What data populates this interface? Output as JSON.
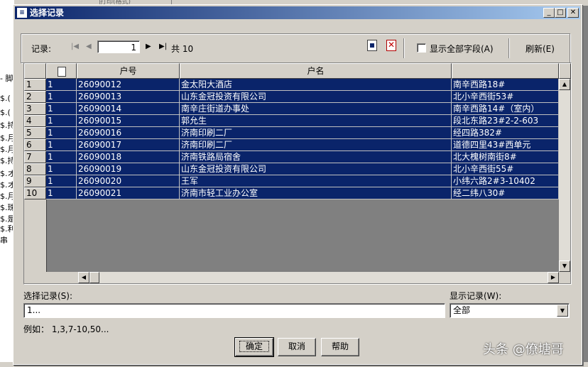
{
  "background": {
    "strip_text": "打印(格式)",
    "left_fragments": [
      "- 脚",
      "$.(",
      "$.(",
      "$.持",
      "$.月",
      "$.月",
      "$.持",
      "$.オ",
      "$.オ",
      "$.月",
      "$.珠",
      "$.是",
      "$.利",
      "串"
    ]
  },
  "window": {
    "title": "选择记录",
    "icon": "app-icon",
    "controls": [
      "minimize",
      "maximize",
      "close"
    ]
  },
  "toolbar": {
    "record_label": "记录:",
    "first_icon": "first-record-icon",
    "prev_icon": "prev-record-icon",
    "page_value": "1",
    "next_icon": "next-record-icon",
    "last_icon": "last-record-icon",
    "total_text": "共 10",
    "show_all_label": "显示全部字段(A)",
    "show_all_checked": false,
    "refresh_label": "刷新(E)"
  },
  "grid": {
    "columns": [
      "",
      "户号",
      "户名",
      ""
    ],
    "selection_color": "#0a246a",
    "rows": [
      {
        "index": "1",
        "flag": "1",
        "account": "26090012",
        "name": "金太阳大酒店",
        "address": "南辛西路18#"
      },
      {
        "index": "2",
        "flag": "1",
        "account": "26090013",
        "name": "山东金冠投资有限公司",
        "address": "北小辛西街53#"
      },
      {
        "index": "3",
        "flag": "1",
        "account": "26090014",
        "name": "南辛庄街道办事处",
        "address": "南辛西路14#（室内）"
      },
      {
        "index": "4",
        "flag": "1",
        "account": "26090015",
        "name": "郭允生",
        "address": "段北东路23#2-2-603"
      },
      {
        "index": "5",
        "flag": "1",
        "account": "26090016",
        "name": "济南印刷二厂",
        "address": "经四路382#"
      },
      {
        "index": "6",
        "flag": "1",
        "account": "26090017",
        "name": "济南印刷二厂",
        "address": "道德四里43#西单元"
      },
      {
        "index": "7",
        "flag": "1",
        "account": "26090018",
        "name": "济南铁路局宿舍",
        "address": "北大槐树南街8#"
      },
      {
        "index": "8",
        "flag": "1",
        "account": "26090019",
        "name": "山东金冠投资有限公司",
        "address": "北小辛西街55#"
      },
      {
        "index": "9",
        "flag": "1",
        "account": "26090020",
        "name": "王军",
        "address": "小纬六路2#3-10402"
      },
      {
        "index": "10",
        "flag": "1",
        "account": "26090021",
        "name": "济南市轻工业办公室",
        "address": "经二纬八30#"
      }
    ]
  },
  "select_records": {
    "label": "选择记录(S):",
    "value": "1..."
  },
  "display_records": {
    "label": "显示记录(W):",
    "value": "全部"
  },
  "example_text": "例如：  1,3,7-10,50...",
  "buttons": {
    "ok": "确定",
    "cancel": "取消",
    "help": "帮助"
  },
  "watermark": "头条 @僚塘哥"
}
